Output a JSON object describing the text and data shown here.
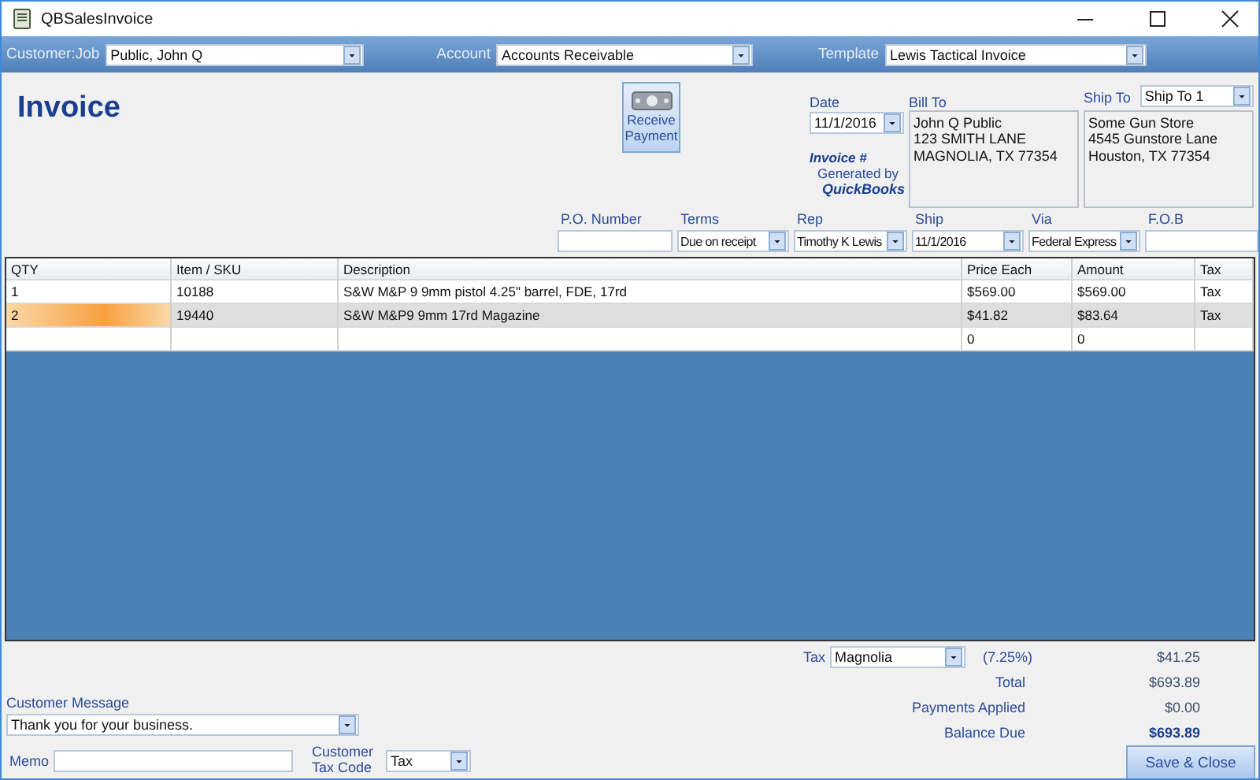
{
  "window": {
    "title": "QBSalesInvoice"
  },
  "toolbar": {
    "fields": [
      {
        "label": "Customer:Job",
        "value": "Public, John Q"
      },
      {
        "label": "Account",
        "value": "Accounts Receivable"
      },
      {
        "label": "Template",
        "value": "Lewis Tactical Invoice"
      }
    ]
  },
  "header": {
    "title": "Invoice",
    "receive_payment_button": "Receive Payment",
    "date": {
      "label": "Date",
      "value": "11/1/2016"
    },
    "invoice_number": {
      "label": "Invoice #",
      "note": "Generated by",
      "brand": "QuickBooks"
    },
    "bill_to": {
      "label": "Bill To",
      "lines": [
        "John Q Public",
        "123 SMITH LANE",
        "MAGNOLIA, TX 77354"
      ]
    },
    "ship_to": {
      "label": "Ship To",
      "selector": "Ship To 1",
      "lines": [
        "Some Gun Store",
        "4545 Gunstore Lane",
        "Houston, TX 77354"
      ]
    }
  },
  "details": [
    {
      "label": "P.O. Number",
      "kind": "text"
    },
    {
      "label": "Terms",
      "kind": "dropdown",
      "value": "Due on receipt"
    },
    {
      "label": "Rep",
      "kind": "dropdown",
      "value": "Timothy K Lewis"
    },
    {
      "label": "Ship",
      "kind": "dropdown",
      "value": "11/1/2016"
    },
    {
      "label": "Via",
      "kind": "dropdown",
      "value": "Federal Express"
    },
    {
      "label": "F.O.B",
      "kind": "text"
    }
  ],
  "table": {
    "columns": [
      "QTY",
      "Item / SKU",
      "Description",
      "Price Each",
      "Amount",
      "Tax"
    ],
    "rows": [
      {
        "qty": "1",
        "item": "10188",
        "description": "S&W M&P 9 9mm pistol 4.25\" barrel, FDE, 17rd",
        "price": "$569.00",
        "amount": "$569.00",
        "tax": "Tax",
        "selected": false
      },
      {
        "qty": "2",
        "item": "19440",
        "description": "S&W M&P9 9mm 17rd Magazine",
        "price": "$41.82",
        "amount": "$83.64",
        "tax": "Tax",
        "selected": true
      },
      {
        "price": "0",
        "amount": "0",
        "selected": false
      }
    ]
  },
  "totals": {
    "tax": {
      "label": "Tax",
      "district": "Magnolia",
      "rate": "(7.25%)",
      "value": "$41.25"
    },
    "lines": [
      {
        "label": "Total",
        "value": "$693.89",
        "bold": false
      },
      {
        "label": "Payments Applied",
        "value": "$0.00",
        "bold": false
      },
      {
        "label": "Balance Due",
        "value": "$693.89",
        "bold": true
      }
    ]
  },
  "footer": {
    "customer_message": {
      "label": "Customer Message",
      "value": "Thank you for your business."
    },
    "memo": {
      "label": "Memo"
    },
    "tax_code": {
      "label": "Customer Tax Code",
      "value": "Tax"
    },
    "save_button": "Save & Close"
  }
}
